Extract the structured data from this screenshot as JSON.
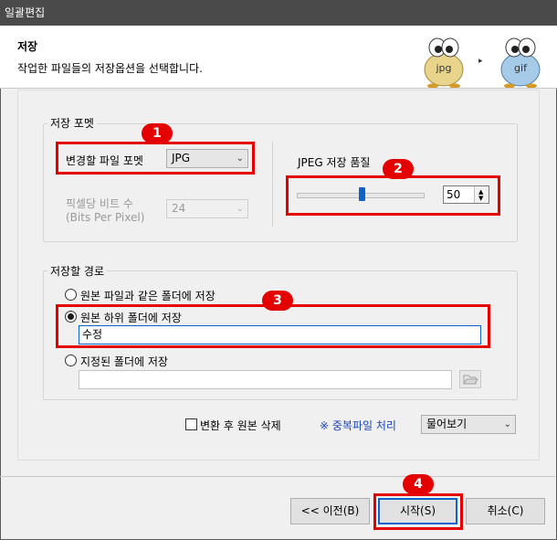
{
  "window": {
    "title": "일괄편집"
  },
  "header": {
    "title": "저장",
    "subtitle": "작업한 파일들의 저장옵션을 선택합니다.",
    "from_format": "jpg",
    "to_format": "gif",
    "arrow": "▸"
  },
  "format_group": {
    "label": "저장 포멧",
    "format_label": "변경할 파일 포멧",
    "format_value": "JPG",
    "bpp_label_1": "픽셀당 비트 수",
    "bpp_label_2": "(Bits Per Pixel)",
    "bpp_value": "24",
    "quality_label": "JPEG 저장 품질",
    "quality_value": "50",
    "quality_fraction": 0.5
  },
  "path_group": {
    "label": "저장할 경로",
    "option_same": "원본 파일과 같은 폴더에 저장",
    "option_sub": "원본 하위 폴더에 저장",
    "subfolder_value": "수정",
    "option_custom": "지정된 폴더에 저장",
    "custom_value": ""
  },
  "options": {
    "delete_original": "변환 후 원본 삭제",
    "duplicate_label": "※ 중복파일 처리",
    "duplicate_value": "물어보기"
  },
  "buttons": {
    "prev": "<< 이전(B)",
    "start": "시작(S)",
    "cancel": "취소(C)"
  },
  "badges": {
    "b1": "1",
    "b2": "2",
    "b3": "3",
    "b4": "4"
  },
  "colors": {
    "annotation_red": "#e40000",
    "focus_blue": "#0a64c9",
    "title_bar": "#4a4a4a"
  }
}
